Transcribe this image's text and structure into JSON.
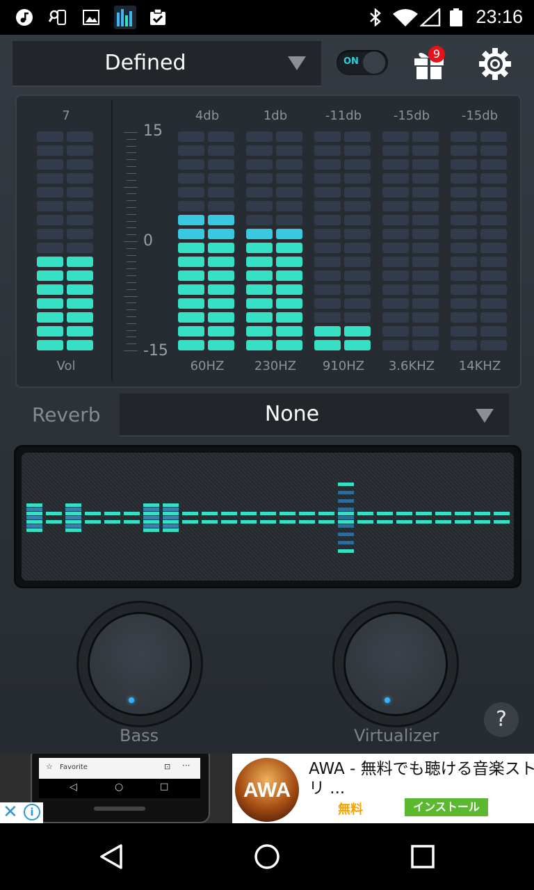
{
  "status_bar": {
    "time": "23:16"
  },
  "header": {
    "preset": "Defined",
    "toggle_label": "ON",
    "gift_badge": "9"
  },
  "equalizer": {
    "volume": {
      "value": "7",
      "label": "Vol",
      "lit_segments": 7
    },
    "scale": {
      "max": "15",
      "mid": "0",
      "min": "-15"
    },
    "bands": [
      {
        "gain": "4db",
        "freq": "60HZ",
        "lit_segments": 10
      },
      {
        "gain": "1db",
        "freq": "230HZ",
        "lit_segments": 9
      },
      {
        "gain": "-11db",
        "freq": "910HZ",
        "lit_segments": 2
      },
      {
        "gain": "-15db",
        "freq": "3.6KHZ",
        "lit_segments": 0
      },
      {
        "gain": "-15db",
        "freq": "14KHZ",
        "lit_segments": 0
      }
    ],
    "total_segments": 16
  },
  "reverb": {
    "label": "Reverb",
    "value": "None"
  },
  "knobs": {
    "bass_label": "Bass",
    "virtualizer_label": "Virtualizer"
  },
  "help": {
    "label": "?"
  },
  "ad": {
    "preview_text": "Favorite",
    "logo_text": "AWA",
    "title_line1": "AWA - 無料でも聴ける音楽スト",
    "title_line2": "リ ...",
    "price": "無料",
    "install_label": "インストール"
  },
  "colors": {
    "accent": "#3fb6f2",
    "teal": "#35e0c4",
    "unlit": "#323b4b",
    "install": "#5cb82e",
    "price": "#f5a300"
  }
}
